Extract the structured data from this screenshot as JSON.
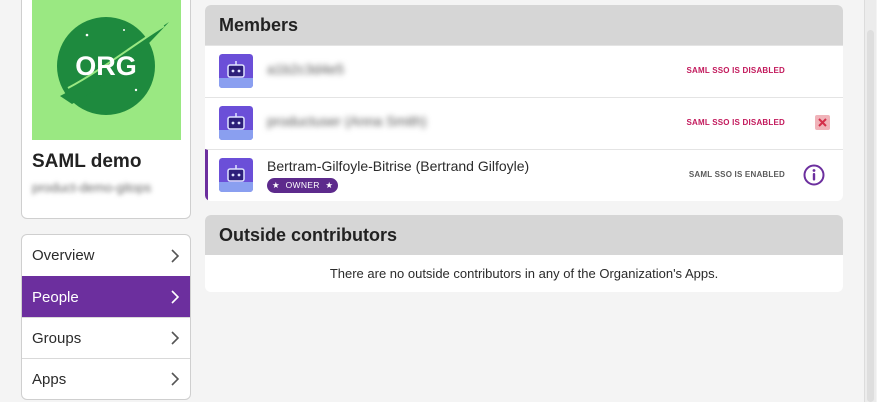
{
  "org": {
    "name": "SAML demo",
    "subtitle": "product-demo-gitops",
    "logo_text": "ORG"
  },
  "nav": {
    "items": [
      {
        "label": "Overview",
        "active": false
      },
      {
        "label": "People",
        "active": true
      },
      {
        "label": "Groups",
        "active": false
      },
      {
        "label": "Apps",
        "active": false
      }
    ]
  },
  "members": {
    "title": "Members",
    "rows": [
      {
        "name": "a1b2c3d4e5",
        "sso": "SAML SSO IS DISABLED",
        "sso_state": "disabled",
        "action": "none"
      },
      {
        "name": "productuser (Anna Smith)",
        "sso": "SAML SSO IS DISABLED",
        "sso_state": "disabled",
        "action": "remove-icon"
      },
      {
        "name": "Bertram-Gilfoyle-Bitrise (Bertrand Gilfoyle)",
        "badge": "OWNER",
        "sso": "SAML SSO IS ENABLED",
        "sso_state": "enabled",
        "action": "info-icon"
      }
    ]
  },
  "outside": {
    "title": "Outside contributors",
    "empty_message": "There are no outside contributors in any of the Organization's Apps."
  },
  "colors": {
    "accent": "#6c2f9e",
    "logo_bg": "#9ae882",
    "logo_circle": "#1e8a3e",
    "sso_disabled": "#c2185b",
    "header_bg": "#d6d6d6"
  }
}
